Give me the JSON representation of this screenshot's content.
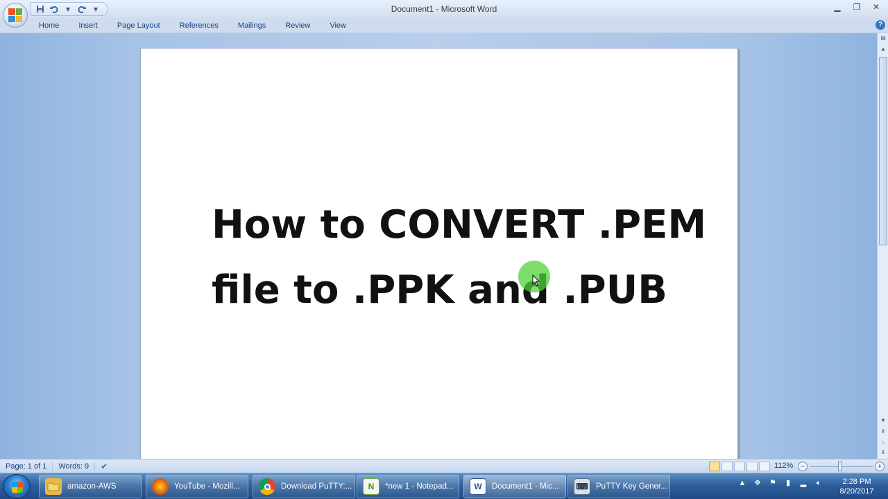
{
  "window": {
    "title": "Document1 - Microsoft Word"
  },
  "quick_access": {
    "save_icon": "save-icon",
    "undo_icon": "undo-icon",
    "redo_icon": "redo-icon",
    "customize_icon": "chevron-down-icon"
  },
  "ribbon": {
    "tabs": [
      "Home",
      "Insert",
      "Page Layout",
      "References",
      "Mailings",
      "Review",
      "View"
    ]
  },
  "document": {
    "lines": [
      "How to CONVERT .PEM",
      "file to .PPK and .PUB"
    ]
  },
  "statusbar": {
    "page": "Page: 1 of 1",
    "words": "Words: 9",
    "zoom": "112%",
    "zoom_out": "−",
    "zoom_in": "+"
  },
  "taskbar": {
    "items": [
      {
        "label": "amazon-AWS",
        "icon": "folder-icon",
        "color": "#e8b94a"
      },
      {
        "label": "YouTube - Mozill...",
        "icon": "firefox-icon",
        "color": "#e66000"
      },
      {
        "label": "Download PuTTY:...",
        "icon": "chrome-icon",
        "color": "#2f9e44"
      },
      {
        "label": "*new 1 - Notepad...",
        "icon": "notepad-plus-plus-icon",
        "color": "#6cae3a"
      },
      {
        "label": "Document1 - Mic...",
        "icon": "word-icon",
        "color": "#2b579a"
      },
      {
        "label": "PuTTY Key Gener...",
        "icon": "puttygen-icon",
        "color": "#5a6e8a"
      }
    ],
    "clock_time": "2:28 PM",
    "clock_date": "8/20/2017"
  },
  "colors": {
    "accent": "#15428b",
    "taskbar": "#2d5f9c",
    "highlight": "#50d23c"
  }
}
